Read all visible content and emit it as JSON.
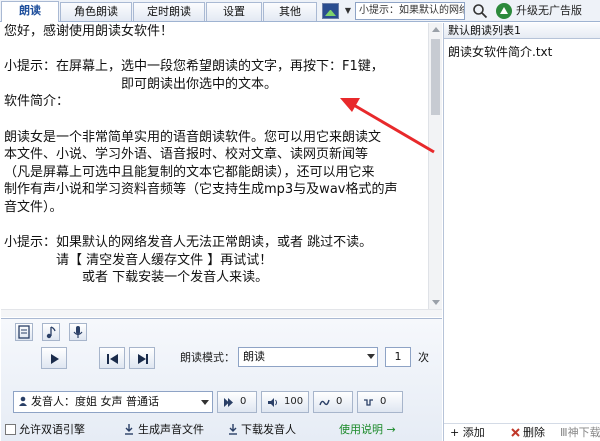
{
  "tabs": [
    {
      "label": "朗读",
      "active": true
    },
    {
      "label": "角色朗读"
    },
    {
      "label": "定时朗读"
    },
    {
      "label": "设置"
    },
    {
      "label": "其他"
    }
  ],
  "tip_text": "小提示：如果默认的网络",
  "upgrade_label": "升级无广告版",
  "main_lines": [
    "您好，感谢使用朗读女软件！",
    "",
    "小提示：在屏幕上，选中一段您希望朗读的文字，再按下：F1键，",
    "　　　　　　　　　即可朗读出你选中的文本。",
    "软件简介：",
    "",
    "朗读女是一个非常简单实用的语音朗读软件。您可以用它来朗读文",
    "本文件、小说、学习外语、语音报时、校对文章、读网页新闻等",
    "（凡是屏幕上可选中且能复制的文本它都能朗读），还可以用它来",
    "制作有声小说和学习资料音频等（它支持生成mp3与及wav格式的声",
    "音文件）。",
    "",
    "小提示：如果默认的网络发音人无法正常朗读，或者 跳过不读。",
    "　　　　请【 清空发音人缓存文件 】再试试！",
    "　　　　　　或者 下载安装一个发音人来读。"
  ],
  "controls": {
    "mode_label": "朗读模式：",
    "mode_value": "朗读",
    "count_value": "1",
    "count_unit": "次",
    "speaker_label": "发音人：度姐 女声 普通话",
    "speed_value": "0",
    "volume_value": "100",
    "tone_value": "0",
    "pitch_value": "0",
    "double_language_label": "允许双语引擎",
    "generate_audio_label": "生成声音文件",
    "download_speaker_label": "下载发音人",
    "help_label": "使用说明 →"
  },
  "playlist": {
    "header": "默认朗读列表1",
    "items": [
      "朗读女软件简介.txt"
    ],
    "add_label": "+ 添加",
    "delete_label": "删除",
    "watermark": "Ⅲ神下载"
  },
  "colors": {
    "active_tab_text": "#1f4f9c",
    "annotation_arrow": "#e8292b",
    "help_link": "#1b8a2a",
    "tab_border": "#a9b9d3"
  },
  "icons": [
    "image-icon",
    "search-icon",
    "upgrade-icon",
    "document-icon",
    "music-icon",
    "microphone-icon",
    "play-icon",
    "previous-icon",
    "next-icon",
    "person-icon",
    "speed-icon",
    "volume-icon",
    "tone-icon",
    "pitch-icon",
    "generate-audio-icon",
    "download-icon",
    "delete-icon"
  ]
}
